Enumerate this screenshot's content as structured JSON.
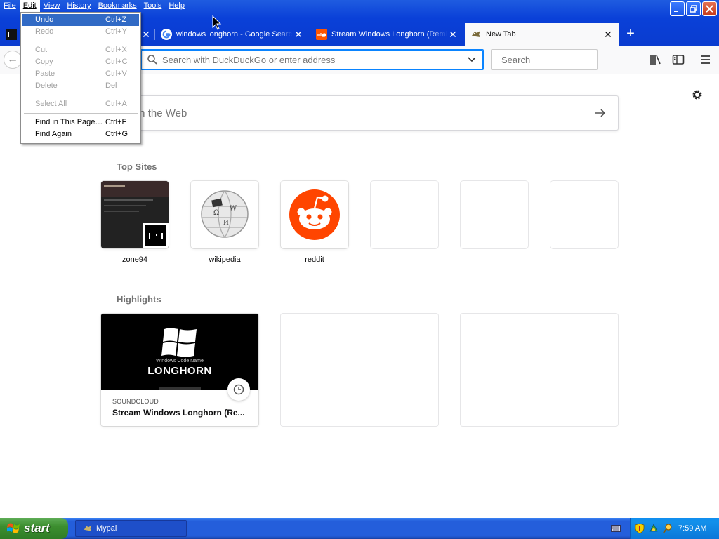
{
  "window": {
    "menus": [
      "File",
      "Edit",
      "View",
      "History",
      "Bookmarks",
      "Tools",
      "Help"
    ],
    "active_menu": "Edit"
  },
  "tabs": [
    {
      "title": "windows longhorn - Google Search",
      "favicon": "google-icon"
    },
    {
      "title": "Stream Windows Longhorn (Remix)",
      "favicon": "soundcloud-icon"
    },
    {
      "title": "New Tab",
      "favicon": "mypal-icon",
      "selected": true
    }
  ],
  "navbar": {
    "url_placeholder": "Search with DuckDuckGo or enter address",
    "search_placeholder": "Search"
  },
  "edit_menu": {
    "items": [
      {
        "label": "Undo",
        "shortcut": "Ctrl+Z",
        "state": "highlighted"
      },
      {
        "label": "Redo",
        "shortcut": "Ctrl+Y",
        "state": "disabled"
      },
      {
        "label": "Cut",
        "shortcut": "Ctrl+X",
        "state": "disabled"
      },
      {
        "label": "Copy",
        "shortcut": "Ctrl+C",
        "state": "disabled"
      },
      {
        "label": "Paste",
        "shortcut": "Ctrl+V",
        "state": "disabled"
      },
      {
        "label": "Delete",
        "shortcut": "Del",
        "state": "disabled"
      },
      {
        "label": "Select All",
        "shortcut": "Ctrl+A",
        "state": "disabled"
      },
      {
        "label": "Find in This Page…",
        "shortcut": "Ctrl+F",
        "state": "enabled"
      },
      {
        "label": "Find Again",
        "shortcut": "Ctrl+G",
        "state": "enabled"
      }
    ]
  },
  "newtab": {
    "web_search_placeholder": "Search the Web",
    "top_sites_title": "Top Sites",
    "top_sites": [
      {
        "label": "zone94"
      },
      {
        "label": "wikipedia"
      },
      {
        "label": "reddit"
      }
    ],
    "highlights_title": "Highlights",
    "highlight": {
      "source": "SOUNDCLOUD",
      "title": "Stream Windows Longhorn (Re...",
      "image_caption_small": "Windows Code Name",
      "image_caption_big": "LONGHORN"
    }
  },
  "taskbar": {
    "start_label": "start",
    "task_label": "Mypal",
    "clock": "7:59 AM"
  },
  "colors": {
    "titlebar": "#0a40d8",
    "menu_highlight": "#316ac5",
    "url_focus": "#0a84ff",
    "reddit": "#ff4500",
    "start_green": "#3c8e2f"
  }
}
